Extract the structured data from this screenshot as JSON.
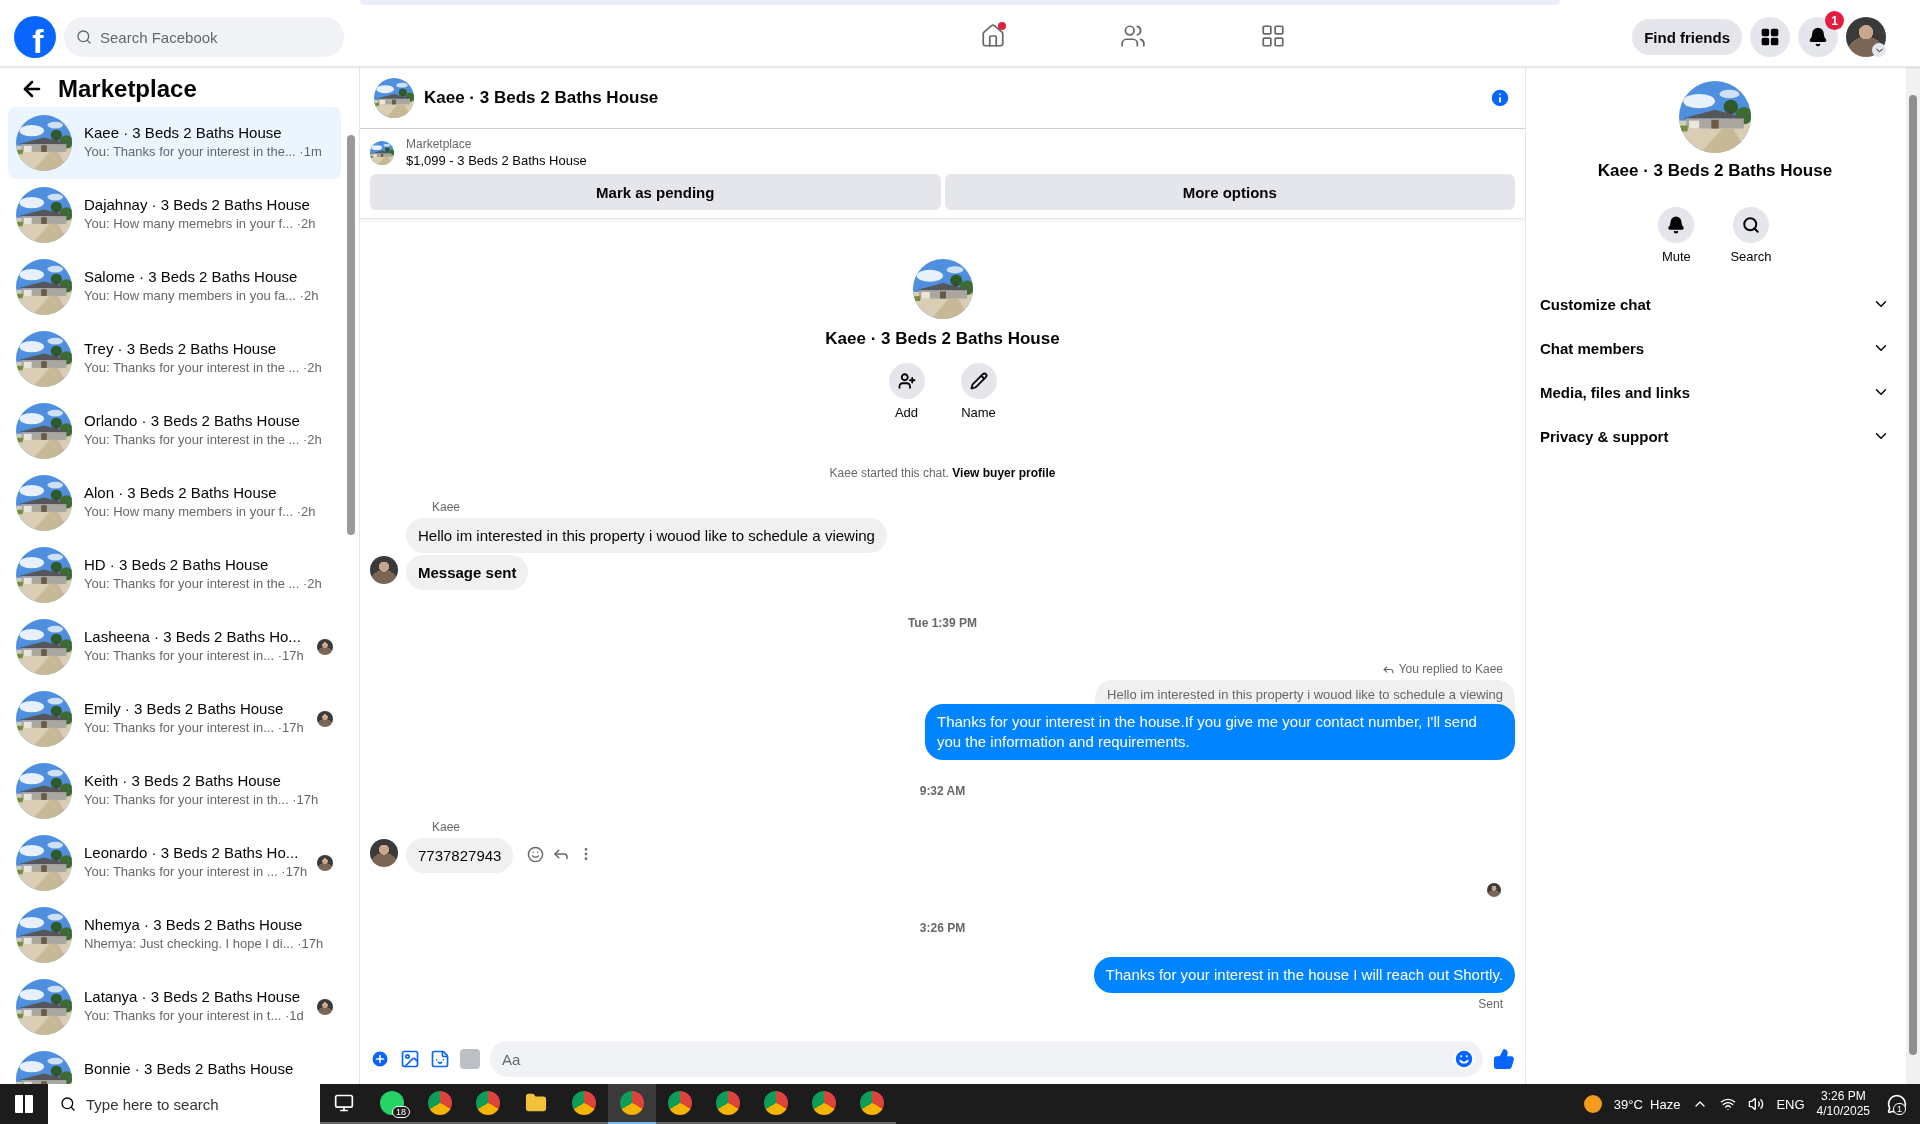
{
  "top_nav": {
    "logo": "f",
    "search_placeholder": "Search Facebook",
    "nav": [
      {
        "kind": "home",
        "selected": false,
        "dot": true
      },
      {
        "kind": "friends",
        "selected": false,
        "dot": false
      },
      {
        "kind": "groups",
        "selected": false,
        "dot": false
      }
    ],
    "find_friends": "Find friends",
    "notification_count": "1"
  },
  "sidebar": {
    "title": "Marketplace",
    "conversations": [
      {
        "name": "Kaee · 3 Beds 2 Baths House",
        "preview": "You: Thanks for your interest in the...",
        "time": "·1m",
        "selected": true,
        "seen_avatar": false
      },
      {
        "name": "Dajahnay · 3 Beds 2 Baths House",
        "preview": "You: How many memebrs in your f...",
        "time": "·2h",
        "selected": false,
        "seen_avatar": false
      },
      {
        "name": "Salome · 3 Beds 2 Baths House",
        "preview": "You: How many members in you fa...",
        "time": "·2h",
        "selected": false,
        "seen_avatar": false
      },
      {
        "name": "Trey · 3 Beds 2 Baths House",
        "preview": "You: Thanks for your interest in the ...",
        "time": "·2h",
        "selected": false,
        "seen_avatar": false
      },
      {
        "name": "Orlando · 3 Beds 2 Baths House",
        "preview": "You: Thanks for your interest in the ...",
        "time": "·2h",
        "selected": false,
        "seen_avatar": false
      },
      {
        "name": "Alon · 3 Beds 2 Baths House",
        "preview": "You: How many members in your f...",
        "time": "·2h",
        "selected": false,
        "seen_avatar": false
      },
      {
        "name": "HD · 3 Beds 2 Baths House",
        "preview": "You: Thanks for your interest in the ...",
        "time": "·2h",
        "selected": false,
        "seen_avatar": false
      },
      {
        "name": "Lasheena · 3 Beds 2 Baths Ho...",
        "preview": "You: Thanks for your interest in...",
        "time": "·17h",
        "selected": false,
        "seen_avatar": true
      },
      {
        "name": "Emily · 3 Beds 2 Baths House",
        "preview": "You: Thanks for your interest in...",
        "time": "·17h",
        "selected": false,
        "seen_avatar": true
      },
      {
        "name": "Keith · 3 Beds 2 Baths House",
        "preview": "You: Thanks for your interest in th...",
        "time": "·17h",
        "selected": false,
        "seen_avatar": false
      },
      {
        "name": "Leonardo · 3 Beds 2 Baths Ho...",
        "preview": "You: Thanks for your interest in ...",
        "time": "·17h",
        "selected": false,
        "seen_avatar": true
      },
      {
        "name": "Nhemya · 3 Beds 2 Baths House",
        "preview": "Nhemya: Just checking. I hope I di...",
        "time": "·17h",
        "selected": false,
        "seen_avatar": false
      },
      {
        "name": "Latanya · 3 Beds 2 Baths House",
        "preview": "You: Thanks for your interest in t...",
        "time": "·1d",
        "selected": false,
        "seen_avatar": true
      },
      {
        "name": "Bonnie · 3 Beds 2 Baths House",
        "selected": false,
        "seen_avatar": false
      }
    ]
  },
  "chat": {
    "title": "Kaee · 3 Beds 2 Baths House",
    "listing": {
      "label": "Marketplace",
      "title": "$1,099 - 3 Beds 2 Baths House"
    },
    "actions": [
      "Mark as pending",
      "More options"
    ],
    "intro": {
      "name": "Kaee · 3 Beds 2 Baths House",
      "buttons": [
        {
          "kind": "add",
          "label": "Add"
        },
        {
          "kind": "name",
          "label": "Name"
        }
      ],
      "started": "Kaee started this chat.",
      "link": "View buyer profile"
    },
    "messages": [
      {
        "kind": "sender",
        "text": "Kaee"
      },
      {
        "kind": "incoming",
        "text": "Hello im interested in this property i wouod like to schedule a viewing",
        "bold": false,
        "avatar": false,
        "actions": false
      },
      {
        "kind": "incoming",
        "text": "Message sent",
        "bold": true,
        "avatar": true,
        "actions": false
      },
      {
        "kind": "time",
        "text": "Tue 1:39 PM"
      },
      {
        "kind": "reply_note",
        "text": "You replied to Kaee"
      },
      {
        "kind": "quote",
        "text": "Hello im interested in this property i wouod like to schedule a viewing"
      },
      {
        "kind": "outgoing",
        "text": "Thanks for your interest in the house.If you give me your contact number, I'll send you the information and requirements."
      },
      {
        "kind": "time",
        "text": "9:32 AM"
      },
      {
        "kind": "sender",
        "text": "Kaee"
      },
      {
        "kind": "incoming",
        "text": "7737827943",
        "bold": false,
        "avatar": true,
        "actions": true
      },
      {
        "kind": "seen"
      },
      {
        "kind": "time",
        "text": "3:26 PM"
      },
      {
        "kind": "outgoing",
        "text": "Thanks for your interest in the house I will reach out Shortly."
      },
      {
        "kind": "status",
        "text": "Sent"
      }
    ],
    "composer": {
      "placeholder": "Aa"
    }
  },
  "details": {
    "name": "Kaee · 3 Beds 2 Baths House",
    "buttons": [
      {
        "kind": "mute",
        "label": "Mute"
      },
      {
        "kind": "search",
        "label": "Search"
      }
    ],
    "sections": [
      {
        "label": "Customize chat",
        "expanded": false
      },
      {
        "label": "Chat members",
        "expanded": false
      },
      {
        "label": "Media, files and links",
        "expanded": false
      },
      {
        "label": "Privacy & support",
        "expanded": false
      }
    ]
  },
  "taskbar": {
    "search_placeholder": "Type here to search",
    "apps": [
      {
        "kind": "taskview",
        "selected": false
      },
      {
        "kind": "chat",
        "selected": false,
        "badge": "18"
      },
      {
        "kind": "browser",
        "selected": false
      },
      {
        "kind": "profile-browser",
        "selected": false
      },
      {
        "kind": "folder",
        "selected": false
      },
      {
        "kind": "profile-browser",
        "selected": false
      },
      {
        "kind": "profile-browser",
        "selected": true
      },
      {
        "kind": "profile-browser",
        "selected": false
      },
      {
        "kind": "profile-browser",
        "selected": false
      },
      {
        "kind": "profile-browser",
        "selected": false
      },
      {
        "kind": "profile-browser",
        "selected": false
      },
      {
        "kind": "profile-browser",
        "selected": false
      }
    ],
    "weather": "39°C  Haze",
    "language": "ENG",
    "time": "3:26 PM",
    "date": "4/10/2025",
    "notifications": "1"
  }
}
